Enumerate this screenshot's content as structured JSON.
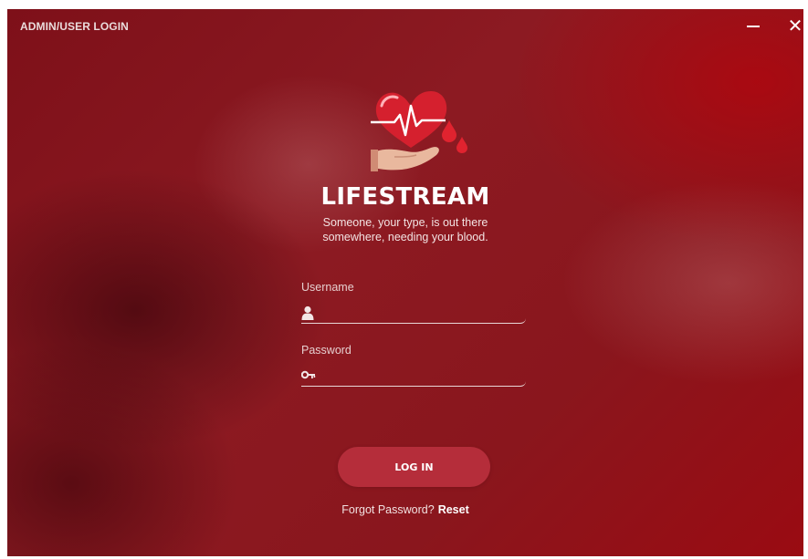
{
  "window": {
    "title": "ADMIN/USER LOGIN",
    "minimize_icon": "minimize-icon",
    "close_icon": "close-icon",
    "close_glyph": "✕"
  },
  "app": {
    "name": "LIFESTREAM",
    "tagline_line1": "Someone, your type, is out there",
    "tagline_line2": "somewhere, needing your blood.",
    "logo_icon": "heart-hand-blood-drop-logo"
  },
  "form": {
    "username_label": "Username",
    "username_value": "",
    "username_icon": "user-icon",
    "password_label": "Password",
    "password_value": "",
    "password_icon": "key-icon",
    "login_label": "LOG IN",
    "forgot_text": "Forgot Password?",
    "reset_label": "Reset"
  },
  "colors": {
    "background": "#8a161d",
    "button": "#b52d3a",
    "text": "#ffffff"
  }
}
